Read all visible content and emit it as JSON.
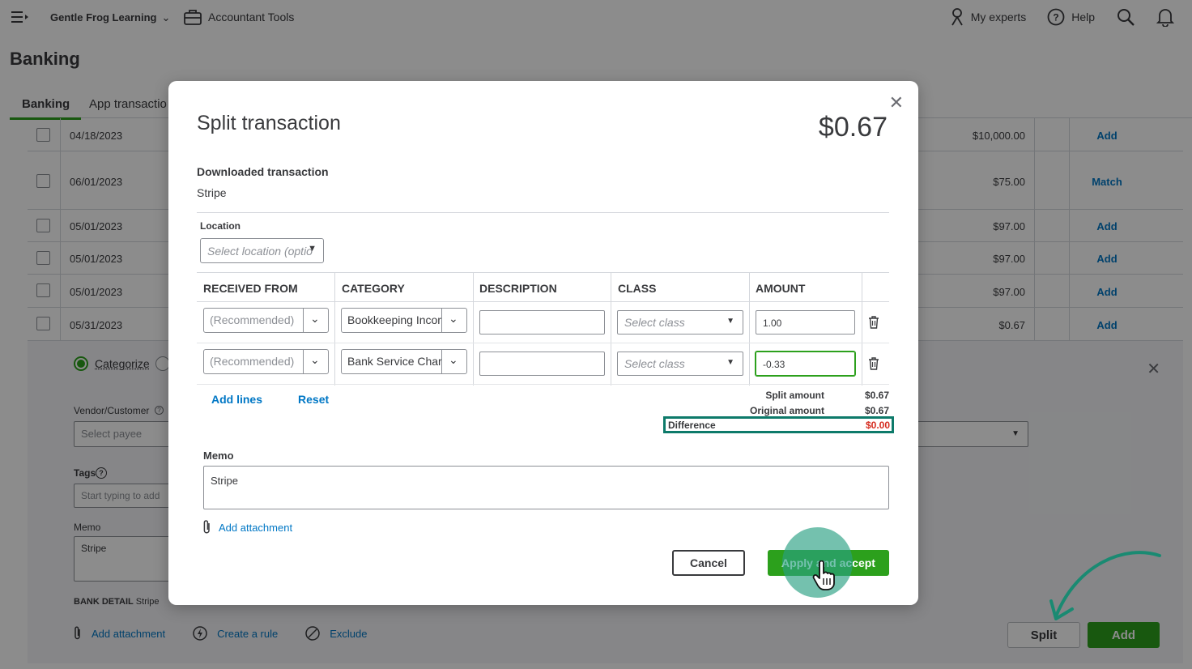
{
  "topbar": {
    "company": "Gentle Frog Learning",
    "accountant_tools": "Accountant Tools",
    "my_experts": "My experts",
    "help": "Help"
  },
  "page": {
    "title": "Banking",
    "tabs": [
      "Banking",
      "App transactio"
    ]
  },
  "transactions": [
    {
      "date": "04/18/2023",
      "amount": "$10,000.00",
      "action": "Add"
    },
    {
      "date": "06/01/2023",
      "amount": "$75.00",
      "action": "Match"
    },
    {
      "date": "05/01/2023",
      "amount": "$97.00",
      "action": "Add"
    },
    {
      "date": "05/01/2023",
      "amount": "$97.00",
      "action": "Add"
    },
    {
      "date": "05/01/2023",
      "amount": "$97.00",
      "action": "Add"
    },
    {
      "date": "05/31/2023",
      "amount": "$0.67",
      "action": "Add"
    }
  ],
  "expanded": {
    "categorize_label": "Categorize",
    "vendor_label": "Vendor/Customer",
    "vendor_placeholder": "Select payee",
    "tags_label": "Tags",
    "tags_placeholder": "Start typing to add",
    "memo_label": "Memo",
    "memo_value": "Stripe",
    "bank_detail_label": "BANK DETAIL",
    "bank_detail_value": "Stripe",
    "add_attachment": "Add attachment",
    "create_rule": "Create a rule",
    "exclude": "Exclude",
    "split_button": "Split",
    "add_button": "Add"
  },
  "modal": {
    "title": "Split transaction",
    "total": "$0.67",
    "downloaded_label": "Downloaded transaction",
    "downloaded_value": "Stripe",
    "location_label": "Location",
    "location_placeholder": "Select location (optio",
    "columns": [
      "RECEIVED FROM",
      "CATEGORY",
      "DESCRIPTION",
      "CLASS",
      "AMOUNT"
    ],
    "lines": [
      {
        "received_from": "(Recommended)",
        "category": "Bookkeeping Income",
        "description": "",
        "class": "Select class",
        "amount": "1.00"
      },
      {
        "received_from": "(Recommended)",
        "category": "Bank Service Charges",
        "description": "",
        "class": "Select class",
        "amount": "-0.33"
      }
    ],
    "add_lines": "Add lines",
    "reset": "Reset",
    "split_amount_label": "Split amount",
    "split_amount": "$0.67",
    "original_amount_label": "Original amount",
    "original_amount": "$0.67",
    "difference_label": "Difference",
    "difference": "$0.00",
    "memo_label": "Memo",
    "memo_value": "Stripe",
    "add_attachment": "Add attachment",
    "cancel": "Cancel",
    "apply": "Apply and accept"
  },
  "colors": {
    "green": "#2ca01c",
    "link": "#0077c5",
    "difference_red": "#d52b1e",
    "highlight_teal": "#0d7a6a"
  }
}
